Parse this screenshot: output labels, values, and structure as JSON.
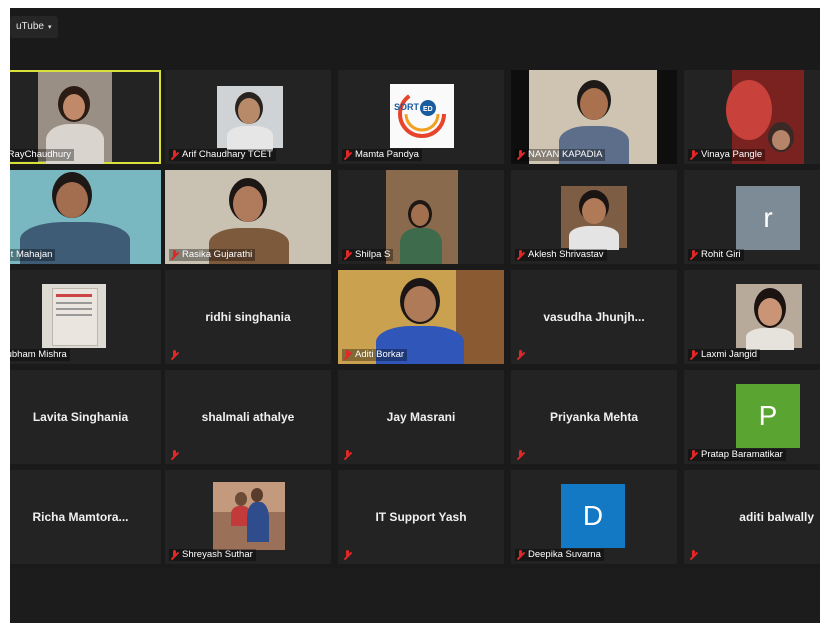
{
  "top_tag": {
    "label": "uTube",
    "chevron": "▾"
  },
  "participants": {
    "p1": {
      "name": "ita RayChaudhury"
    },
    "p2": {
      "name": "Arif Chaudhary TCET"
    },
    "p3": {
      "name": "Mamta Pandya"
    },
    "p4": {
      "name": "NAYAN KAPADIA"
    },
    "p5": {
      "name": "Vinaya Pangle"
    },
    "p6": {
      "name": "Vinit Mahajan"
    },
    "p7": {
      "name": "Rasika Gujarathi"
    },
    "p8": {
      "name": "Shilpa S"
    },
    "p9": {
      "name": "Aklesh Shrivastav"
    },
    "p10": {
      "name": "Rohit Giri",
      "avatar_letter": "r",
      "avatar_color": "#7d8b96"
    },
    "p11": {
      "name": "Shubham Mishra"
    },
    "p12": {
      "name": "ridhi singhania"
    },
    "p13": {
      "name": "Aditi Borkar"
    },
    "p14": {
      "name": "vasudha  Jhunjh..."
    },
    "p15": {
      "name": "Laxmi Jangid"
    },
    "p16": {
      "name": "Lavita Singhania"
    },
    "p17": {
      "name": "shalmali athalye"
    },
    "p18": {
      "name": "Jay Masrani"
    },
    "p19": {
      "name": "Priyanka Mehta"
    },
    "p20": {
      "name": "Pratap Baramatikar",
      "avatar_letter": "P",
      "avatar_color": "#5aa532"
    },
    "p21": {
      "name": "Richa  Mamtora..."
    },
    "p22": {
      "name": "Shreyash Suthar"
    },
    "p23": {
      "name": "IT Support Yash"
    },
    "p24": {
      "name": "Deepika Suvarna",
      "avatar_letter": "D",
      "avatar_color": "#1479c4"
    },
    "p25": {
      "name": "aditi balwally"
    }
  },
  "colors": {
    "background": "#1a1a1a",
    "tile": "#232323",
    "active_speaker_border": "#d8e03a",
    "muted_mic": "#e02828"
  },
  "mamta_logo": {
    "text": "SORT",
    "badge": "ED"
  }
}
